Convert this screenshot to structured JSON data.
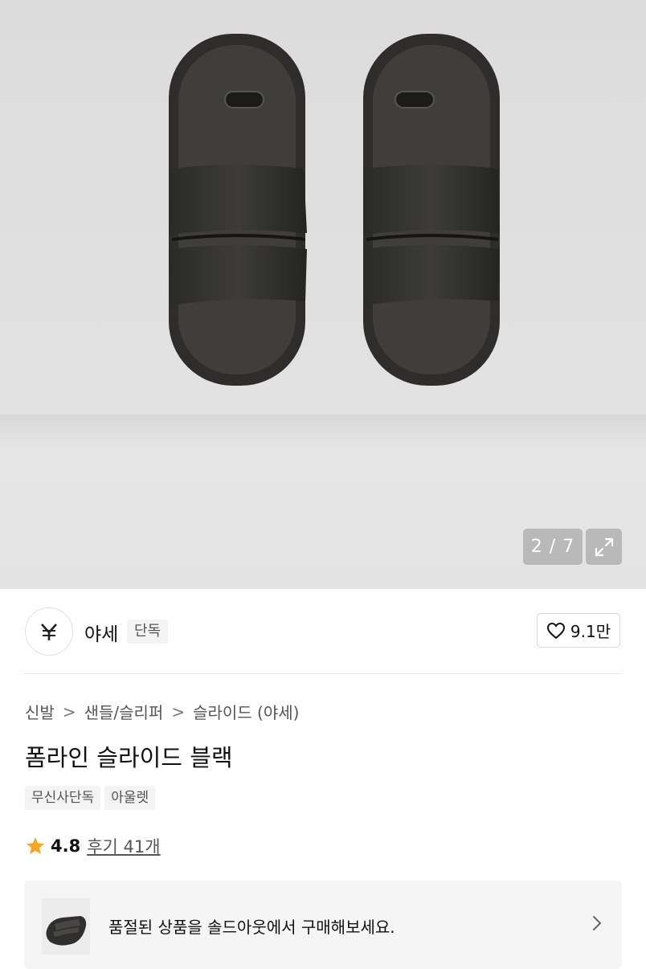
{
  "gallery": {
    "counter": "2 / 7",
    "expand_icon": "expand-icon"
  },
  "brand": {
    "logo_text": "Y̶",
    "name": "야세",
    "exclusive_label": "단독"
  },
  "like": {
    "icon": "heart-icon",
    "count": "9.1만"
  },
  "breadcrumb": {
    "items": [
      "신발",
      "샌들/슬리퍼",
      "슬라이드 (야세)"
    ],
    "separator": ">"
  },
  "product": {
    "title": "폼라인 슬라이드 블랙",
    "tags": [
      "무신사단독",
      "아울렛"
    ],
    "rating": "4.8",
    "reviews": "후기 41개"
  },
  "soldout_banner": {
    "text": "품절된 상품을 솔드아웃에서 구매해보세요.",
    "chevron_icon": "chevron-right-icon"
  }
}
